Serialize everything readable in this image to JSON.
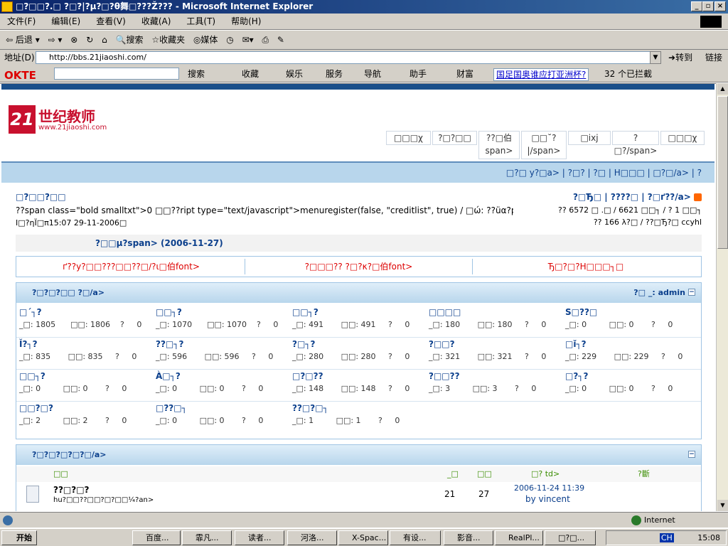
{
  "window": {
    "title": "□?□□?.□ ?□?|?μ?□?θ舞□???Ž??? - Microsoft Internet Explorer"
  },
  "menu": [
    "文件(F)",
    "编辑(E)",
    "查看(V)",
    "收藏(A)",
    "工具(T)",
    "帮助(H)"
  ],
  "toolbar": {
    "back": "后退",
    "search": "搜索",
    "favorites": "收藏夹",
    "media": "媒体"
  },
  "address": {
    "label": "地址(D)",
    "url": "http://bbs.21jiaoshi.com/",
    "go": "转到",
    "links": "链接"
  },
  "okte": {
    "logo": "OKTE",
    "search": "搜索",
    "fav": "收藏",
    "ent": "娱乐",
    "svc": "服务",
    "nav": "导航",
    "helper": "助手",
    "wealth": "财富",
    "news": "国足国奥谁应打亚洲杯?",
    "blocked": "32 个已拦截"
  },
  "site": {
    "logo_text": "世纪教师",
    "logo_url": "www.21jiaoshi.com"
  },
  "tabs": [
    "□□□χ",
    "?□?□□",
    "??□伯",
    "□□˘?",
    "□ixj",
    "?□?/span>",
    "□□□χ"
  ],
  "tab_sub": [
    "span>",
    "|/span>"
  ],
  "subnav": "□?□  у?□a> | ?□? | ?□ | H□□□ | □?□/a> | ?",
  "info": {
    "title": "□?□□?□□",
    "line2": "??span class=\"bold smalltxt\">0  □□??ript type=\"text/javascript\">menuregister(false, \"creditlist\", true) / □ώ: ??üα?pan>",
    "line3": "Ι□?ηΪ□π15:07 29-11-2006□",
    "right1": "?□Ђ□ | ????□ | ?□ґ??/a>",
    "right2": "?? 6572 □ .□ / 6621 □□┐ / ?   1 □□┐",
    "right3": "?? 166 λ?□ / ??□Ђ?□  ccyhl"
  },
  "announce": "?□□μ?span> (2006-11-27)",
  "links3": [
    "ґ??у?□□???□□??□∕?ι□伯font>",
    "?□□□??   ?□?κ?□伯font>",
    "Ђ□?□?H□□□┐□"
  ],
  "panel1": {
    "title": "?□?□?□□  ?□/a>",
    "right": "?□   _: admin",
    "forums": [
      {
        "name": "□ˊ┐?",
        "stat": "_□: 1805      □□: 1806    ?     0"
      },
      {
        "name": "□□┐?",
        "stat": "_□: 1070      □□: 1070    ?     0"
      },
      {
        "name": "□□┐?",
        "stat": "_□: 491       □□: 491     ?     0"
      },
      {
        "name": "□□□□",
        "stat": "_□: 180       □□: 180     ?     0"
      },
      {
        "name": "S□??□",
        "stat": "_□: 0         □□: 0       ?     0"
      },
      {
        "name": "Ĭ?┐?",
        "stat": "_□: 835       □□: 835     ?     0"
      },
      {
        "name": "??□┐?",
        "stat": "_□: 596       □□: 596     ?     0"
      },
      {
        "name": "?□┐?",
        "stat": "_□: 280       □□: 280     ?     0"
      },
      {
        "name": "?□□?",
        "stat": "_□: 321       □□: 321     ?     0"
      },
      {
        "name": "□ǐ┐?",
        "stat": "_□: 229       □□: 229     ?     0"
      },
      {
        "name": "□□┐?",
        "stat": "_□: 0         □□: 0       ?     0"
      },
      {
        "name": "À□┐?",
        "stat": "_□: 0         □□: 0       ?     0"
      },
      {
        "name": "□?□??",
        "stat": "_□: 148       □□: 148     ?     0"
      },
      {
        "name": "?□□??",
        "stat": "_□: 3         □□: 3       ?     0"
      },
      {
        "name": "□?┐?",
        "stat": "_□: 0         □□: 0       ?     0"
      },
      {
        "name": "□□?□?",
        "stat": "_□: 2         □□: 2       ?     0"
      },
      {
        "name": "□??□┐",
        "stat": "_□: 0         □□: 0       ?     0"
      },
      {
        "name": "??□?□┐",
        "stat": "_□: 1         □□: 1       ?     0"
      }
    ]
  },
  "panel2": {
    "title": "?□?□?□?□?□/a>",
    "head": [
      "□□",
      "_□",
      "□□",
      "□?  td>",
      "?斷"
    ],
    "row": {
      "title": "??□?□?",
      "desc": "hu?□□??□□?□?□□¼?an>",
      "replies": "21",
      "views": "27",
      "date": "2006-11-24 11:39",
      "by": "by vincent"
    }
  },
  "status": {
    "zone": "Internet"
  },
  "taskbar": {
    "start": "开始",
    "tasks": [
      "百度...",
      "霏凡...",
      "读者...",
      "河洛...",
      "X-Spac...",
      "有设...",
      "影音...",
      "RealPl...",
      "□?□..."
    ],
    "clock": "15:08",
    "lang": "CH"
  }
}
